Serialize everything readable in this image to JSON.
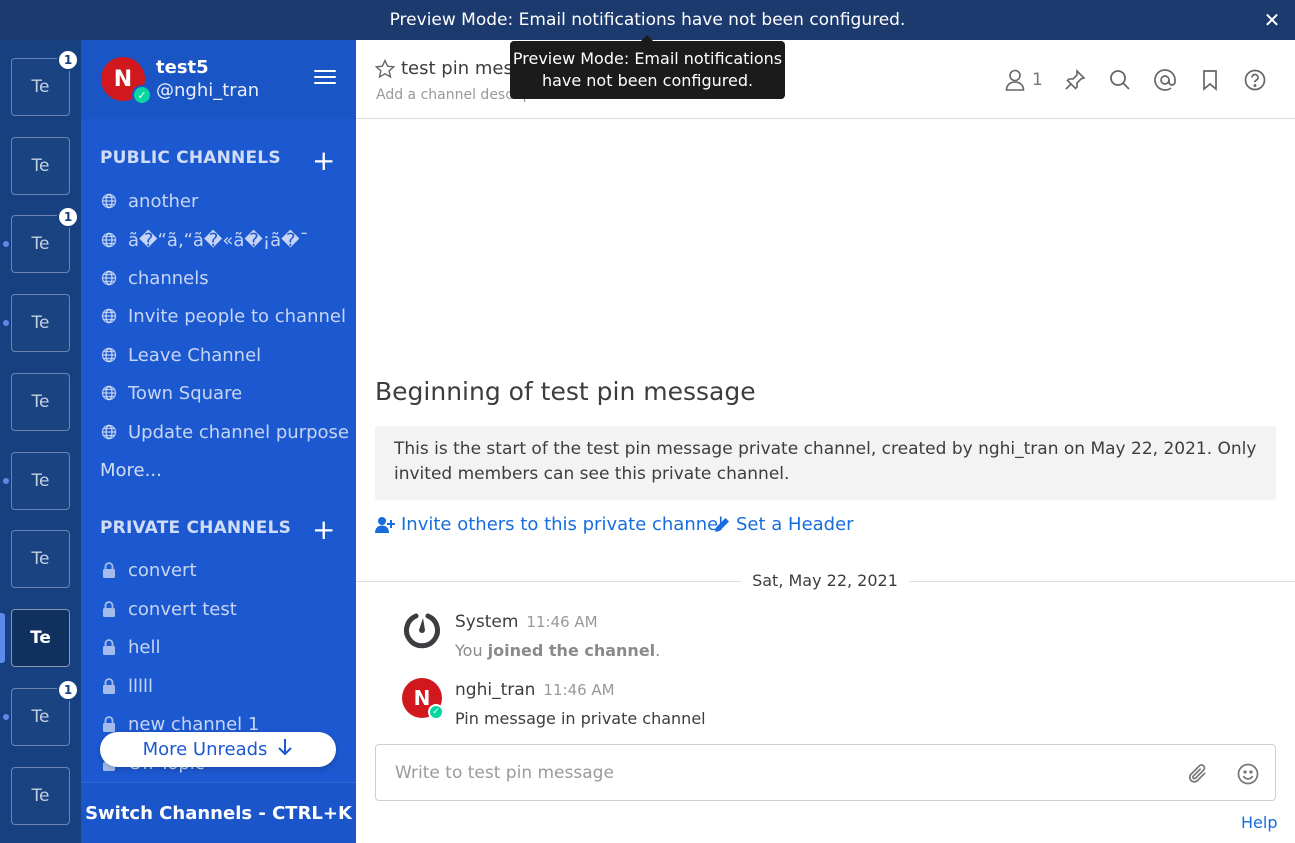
{
  "announcement": {
    "text": "Preview Mode: Email notifications have not been configured.",
    "close_glyph": "✕"
  },
  "tooltip": {
    "line1": "Preview Mode: Email notifications",
    "line2": "have not been configured."
  },
  "teams": [
    {
      "label": "Te",
      "badge": "1",
      "dot": false,
      "active": false
    },
    {
      "label": "Te",
      "badge": "",
      "dot": false,
      "active": false
    },
    {
      "label": "Te",
      "badge": "1",
      "dot": true,
      "active": false
    },
    {
      "label": "Te",
      "badge": "",
      "dot": true,
      "active": false
    },
    {
      "label": "Te",
      "badge": "",
      "dot": false,
      "active": false
    },
    {
      "label": "Te",
      "badge": "",
      "dot": true,
      "active": false
    },
    {
      "label": "Te",
      "badge": "",
      "dot": false,
      "active": false
    },
    {
      "label": "Te",
      "badge": "",
      "dot": false,
      "active": true
    },
    {
      "label": "Te",
      "badge": "1",
      "dot": true,
      "active": false
    },
    {
      "label": "Te",
      "badge": "",
      "dot": false,
      "active": false
    }
  ],
  "sidebar": {
    "team_name": "test5",
    "user_handle": "@nghi_tran",
    "avatar_initial": "N",
    "public_title": "PUBLIC CHANNELS",
    "public_channels": [
      "another",
      "ã�“ã‚“ã�«ã�¡ã�¯",
      "channels",
      "Invite people to channel",
      "Leave Channel",
      "Town Square",
      "Update channel purpose"
    ],
    "more_label": "More...",
    "private_title": "PRIVATE CHANNELS",
    "private_channels": [
      "convert",
      "convert test",
      "hell",
      "lllll",
      "new channel 1",
      "Off-Topic"
    ],
    "more_unreads": "More Unreads",
    "switch_channels": "Switch Channels - CTRL+K",
    "add_glyph": "+"
  },
  "header": {
    "channel_name": "test pin message",
    "channel_description": "Add a channel description",
    "member_count": "1",
    "icons": [
      "member-icon",
      "pin-icon",
      "search-icon",
      "mention-icon",
      "bookmark-icon",
      "help-icon"
    ]
  },
  "intro": {
    "title": "Beginning of test pin message",
    "text": "This is the start of the test pin message private channel, created by nghi_tran on May 22, 2021. Only invited members can see this private channel.",
    "invite_label": "Invite others to this private channel",
    "header_label": "Set a Header"
  },
  "date_separator": "Sat, May 22, 2021",
  "posts": [
    {
      "author": "System",
      "time": "11:46 AM",
      "text_prefix": "You ",
      "text_bold": "joined the channel",
      "text_suffix": "."
    },
    {
      "author": "nghi_tran",
      "time": "11:46 AM",
      "text": "Pin message in private channel",
      "avatar_initial": "N"
    }
  ],
  "composer": {
    "placeholder": "Write to test pin message"
  },
  "help_label": "Help",
  "colors": {
    "announce_bg": "#1c3a6e",
    "team_sidebar_bg": "#16407f",
    "channel_sidebar_bg": "#1c58d0",
    "link": "#166de0",
    "avatar_red": "#d0181e",
    "online_green": "#06d6a0"
  }
}
